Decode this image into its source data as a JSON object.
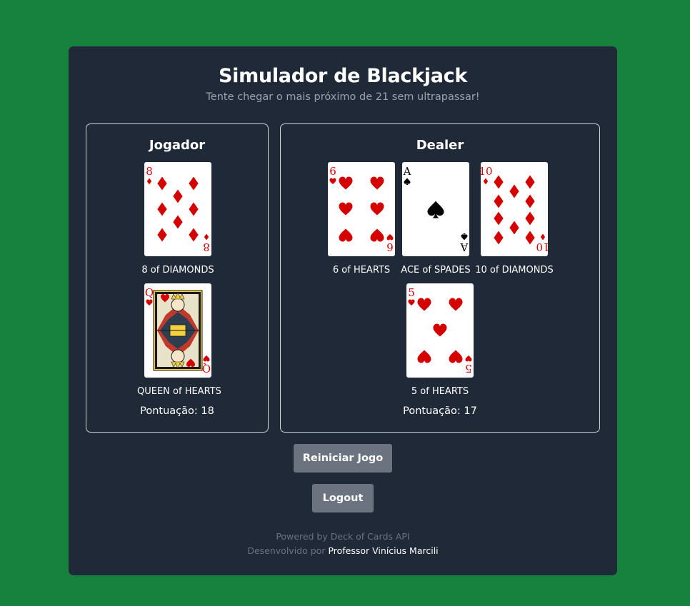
{
  "header": {
    "title": "Simulador de Blackjack",
    "subtitle": "Tente chegar o mais próximo de 21 sem ultrapassar!"
  },
  "player": {
    "title": "Jogador",
    "cards": [
      {
        "label": "8 of DIAMONDS",
        "rank": "8",
        "suit": "diamonds"
      },
      {
        "label": "QUEEN of HEARTS",
        "rank": "Q",
        "suit": "hearts"
      }
    ],
    "score_text": "Pontuação: 18"
  },
  "dealer": {
    "title": "Dealer",
    "cards": [
      {
        "label": "6 of HEARTS",
        "rank": "6",
        "suit": "hearts"
      },
      {
        "label": "ACE of SPADES",
        "rank": "A",
        "suit": "spades"
      },
      {
        "label": "10 of DIAMONDS",
        "rank": "10",
        "suit": "diamonds"
      },
      {
        "label": "5 of HEARTS",
        "rank": "5",
        "suit": "hearts"
      }
    ],
    "score_text": "Pontuação: 17"
  },
  "buttons": {
    "restart": "Reiniciar Jogo",
    "logout": "Logout"
  },
  "footer": {
    "powered": "Powered by Deck of Cards API",
    "developed_prefix": "Desenvolvido por",
    "author": "Professor Vinícius Marcili"
  },
  "colors": {
    "background": "#17823d",
    "panel": "#1f2937",
    "button": "#6b7280",
    "red_suit": "#d40000",
    "black_suit": "#000000"
  }
}
